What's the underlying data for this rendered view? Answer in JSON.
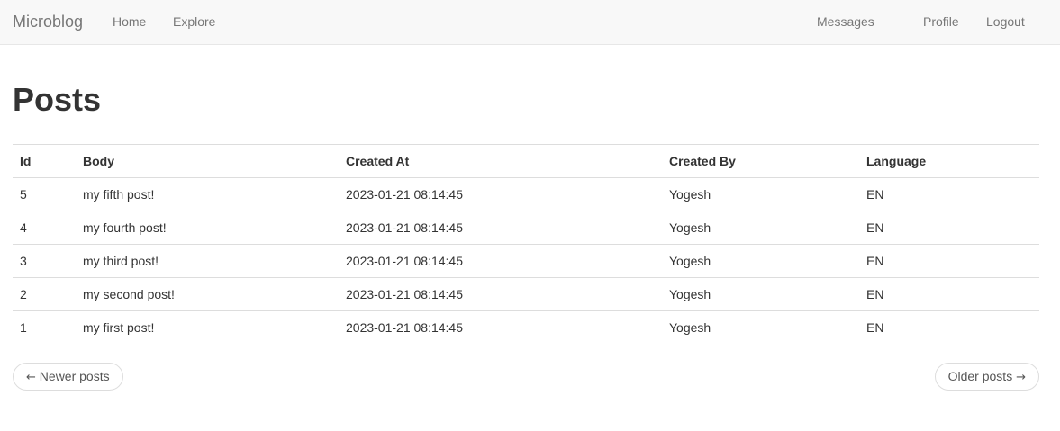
{
  "navbar": {
    "brand": "Microblog",
    "links": {
      "home": "Home",
      "explore": "Explore",
      "messages": "Messages",
      "profile": "Profile",
      "logout": "Logout"
    }
  },
  "page": {
    "title": "Posts"
  },
  "table": {
    "headers": [
      "Id",
      "Body",
      "Created At",
      "Created By",
      "Language"
    ],
    "rows": [
      [
        "5",
        "my fifth post!",
        "2023-01-21 08:14:45",
        "Yogesh",
        "EN"
      ],
      [
        "4",
        "my fourth post!",
        "2023-01-21 08:14:45",
        "Yogesh",
        "EN"
      ],
      [
        "3",
        "my third post!",
        "2023-01-21 08:14:45",
        "Yogesh",
        "EN"
      ],
      [
        "2",
        "my second post!",
        "2023-01-21 08:14:45",
        "Yogesh",
        "EN"
      ],
      [
        "1",
        "my first post!",
        "2023-01-21 08:14:45",
        "Yogesh",
        "EN"
      ]
    ]
  },
  "pager": {
    "newer_arrow": "←",
    "newer_label": "Newer posts",
    "older_label": "Older posts",
    "older_arrow": "→"
  }
}
